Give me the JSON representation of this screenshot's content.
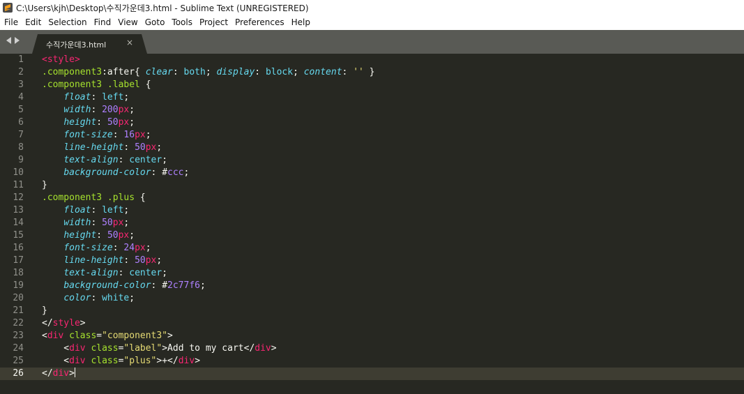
{
  "window": {
    "title": "C:\\Users\\kjh\\Desktop\\수직가운데3.html - Sublime Text (UNREGISTERED)"
  },
  "menu": [
    "File",
    "Edit",
    "Selection",
    "Find",
    "View",
    "Goto",
    "Tools",
    "Project",
    "Preferences",
    "Help"
  ],
  "tab": {
    "label": "수직가운데3.html",
    "close": "×"
  },
  "editor": {
    "active_line": 26,
    "lines": [
      {
        "no": "1",
        "tokens": [
          [
            "t",
            "<style>"
          ]
        ]
      },
      {
        "no": "2",
        "tokens": [
          [
            "c",
            ".component3"
          ],
          [
            "k",
            ":after{ "
          ],
          [
            "p",
            "clear"
          ],
          [
            "k",
            ": "
          ],
          [
            "v",
            "both"
          ],
          [
            "k",
            "; "
          ],
          [
            "p",
            "display"
          ],
          [
            "k",
            ": "
          ],
          [
            "v",
            "block"
          ],
          [
            "k",
            "; "
          ],
          [
            "p",
            "content"
          ],
          [
            "k",
            ": "
          ],
          [
            "s",
            "''"
          ],
          [
            "k",
            " }"
          ]
        ]
      },
      {
        "no": "3",
        "tokens": [
          [
            "c",
            ".component3 .label"
          ],
          [
            "k",
            " {"
          ]
        ]
      },
      {
        "no": "4",
        "tokens": [
          [
            "k",
            "    "
          ],
          [
            "p",
            "float"
          ],
          [
            "k",
            ": "
          ],
          [
            "v",
            "left"
          ],
          [
            "k",
            ";"
          ]
        ]
      },
      {
        "no": "5",
        "tokens": [
          [
            "k",
            "    "
          ],
          [
            "p",
            "width"
          ],
          [
            "k",
            ": "
          ],
          [
            "n",
            "200"
          ],
          [
            "t",
            "px"
          ],
          [
            "k",
            ";"
          ]
        ]
      },
      {
        "no": "6",
        "tokens": [
          [
            "k",
            "    "
          ],
          [
            "p",
            "height"
          ],
          [
            "k",
            ": "
          ],
          [
            "n",
            "50"
          ],
          [
            "t",
            "px"
          ],
          [
            "k",
            ";"
          ]
        ]
      },
      {
        "no": "7",
        "tokens": [
          [
            "k",
            "    "
          ],
          [
            "p",
            "font-size"
          ],
          [
            "k",
            ": "
          ],
          [
            "n",
            "16"
          ],
          [
            "t",
            "px"
          ],
          [
            "k",
            ";"
          ]
        ]
      },
      {
        "no": "8",
        "tokens": [
          [
            "k",
            "    "
          ],
          [
            "p",
            "line-height"
          ],
          [
            "k",
            ": "
          ],
          [
            "n",
            "50"
          ],
          [
            "t",
            "px"
          ],
          [
            "k",
            ";"
          ]
        ]
      },
      {
        "no": "9",
        "tokens": [
          [
            "k",
            "    "
          ],
          [
            "p",
            "text-align"
          ],
          [
            "k",
            ": "
          ],
          [
            "v",
            "center"
          ],
          [
            "k",
            ";"
          ]
        ]
      },
      {
        "no": "10",
        "tokens": [
          [
            "k",
            "    "
          ],
          [
            "p",
            "background-color"
          ],
          [
            "k",
            ": #"
          ],
          [
            "n",
            "ccc"
          ],
          [
            "k",
            ";"
          ]
        ]
      },
      {
        "no": "11",
        "tokens": [
          [
            "k",
            "}"
          ]
        ]
      },
      {
        "no": "12",
        "tokens": [
          [
            "c",
            ".component3 .plus"
          ],
          [
            "k",
            " {"
          ]
        ]
      },
      {
        "no": "13",
        "tokens": [
          [
            "k",
            "    "
          ],
          [
            "p",
            "float"
          ],
          [
            "k",
            ": "
          ],
          [
            "v",
            "left"
          ],
          [
            "k",
            ";"
          ]
        ]
      },
      {
        "no": "14",
        "tokens": [
          [
            "k",
            "    "
          ],
          [
            "p",
            "width"
          ],
          [
            "k",
            ": "
          ],
          [
            "n",
            "50"
          ],
          [
            "t",
            "px"
          ],
          [
            "k",
            ";"
          ]
        ]
      },
      {
        "no": "15",
        "tokens": [
          [
            "k",
            "    "
          ],
          [
            "p",
            "height"
          ],
          [
            "k",
            ": "
          ],
          [
            "n",
            "50"
          ],
          [
            "t",
            "px"
          ],
          [
            "k",
            ";"
          ]
        ]
      },
      {
        "no": "16",
        "tokens": [
          [
            "k",
            "    "
          ],
          [
            "p",
            "font-size"
          ],
          [
            "k",
            ": "
          ],
          [
            "n",
            "24"
          ],
          [
            "t",
            "px"
          ],
          [
            "k",
            ";"
          ]
        ]
      },
      {
        "no": "17",
        "tokens": [
          [
            "k",
            "    "
          ],
          [
            "p",
            "line-height"
          ],
          [
            "k",
            ": "
          ],
          [
            "n",
            "50"
          ],
          [
            "t",
            "px"
          ],
          [
            "k",
            ";"
          ]
        ]
      },
      {
        "no": "18",
        "tokens": [
          [
            "k",
            "    "
          ],
          [
            "p",
            "text-align"
          ],
          [
            "k",
            ": "
          ],
          [
            "v",
            "center"
          ],
          [
            "k",
            ";"
          ]
        ]
      },
      {
        "no": "19",
        "tokens": [
          [
            "k",
            "    "
          ],
          [
            "p",
            "background-color"
          ],
          [
            "k",
            ": #"
          ],
          [
            "n",
            "2c77f6"
          ],
          [
            "k",
            ";"
          ]
        ]
      },
      {
        "no": "20",
        "tokens": [
          [
            "k",
            "    "
          ],
          [
            "p",
            "color"
          ],
          [
            "k",
            ": "
          ],
          [
            "v",
            "white"
          ],
          [
            "k",
            ";"
          ]
        ]
      },
      {
        "no": "21",
        "tokens": [
          [
            "k",
            "}"
          ]
        ]
      },
      {
        "no": "22",
        "tokens": [
          [
            "k",
            "</"
          ],
          [
            "t",
            "style"
          ],
          [
            "k",
            ">"
          ]
        ]
      },
      {
        "no": "23",
        "tokens": [
          [
            "k",
            "<"
          ],
          [
            "t",
            "div"
          ],
          [
            "k",
            " "
          ],
          [
            "c",
            "class"
          ],
          [
            "k",
            "="
          ],
          [
            "s",
            "\"component3\""
          ],
          [
            "k",
            ">"
          ]
        ]
      },
      {
        "no": "24",
        "tokens": [
          [
            "k",
            "    <"
          ],
          [
            "t",
            "div"
          ],
          [
            "k",
            " "
          ],
          [
            "c",
            "class"
          ],
          [
            "k",
            "="
          ],
          [
            "s",
            "\"label\""
          ],
          [
            "k",
            ">Add to my cart</"
          ],
          [
            "t",
            "div"
          ],
          [
            "k",
            ">"
          ]
        ]
      },
      {
        "no": "25",
        "tokens": [
          [
            "k",
            "    <"
          ],
          [
            "t",
            "div"
          ],
          [
            "k",
            " "
          ],
          [
            "c",
            "class"
          ],
          [
            "k",
            "="
          ],
          [
            "s",
            "\"plus\""
          ],
          [
            "k",
            ">+</"
          ],
          [
            "t",
            "div"
          ],
          [
            "k",
            ">"
          ]
        ]
      },
      {
        "no": "26",
        "tokens": [
          [
            "k",
            "</"
          ],
          [
            "t",
            "div"
          ],
          [
            "k",
            ">"
          ]
        ]
      }
    ]
  },
  "colors": {
    "background": "#272822",
    "tag": "#f92672",
    "property": "#66d9ef",
    "number": "#ae81ff",
    "string": "#e6db74",
    "selector": "#a6e22e"
  }
}
